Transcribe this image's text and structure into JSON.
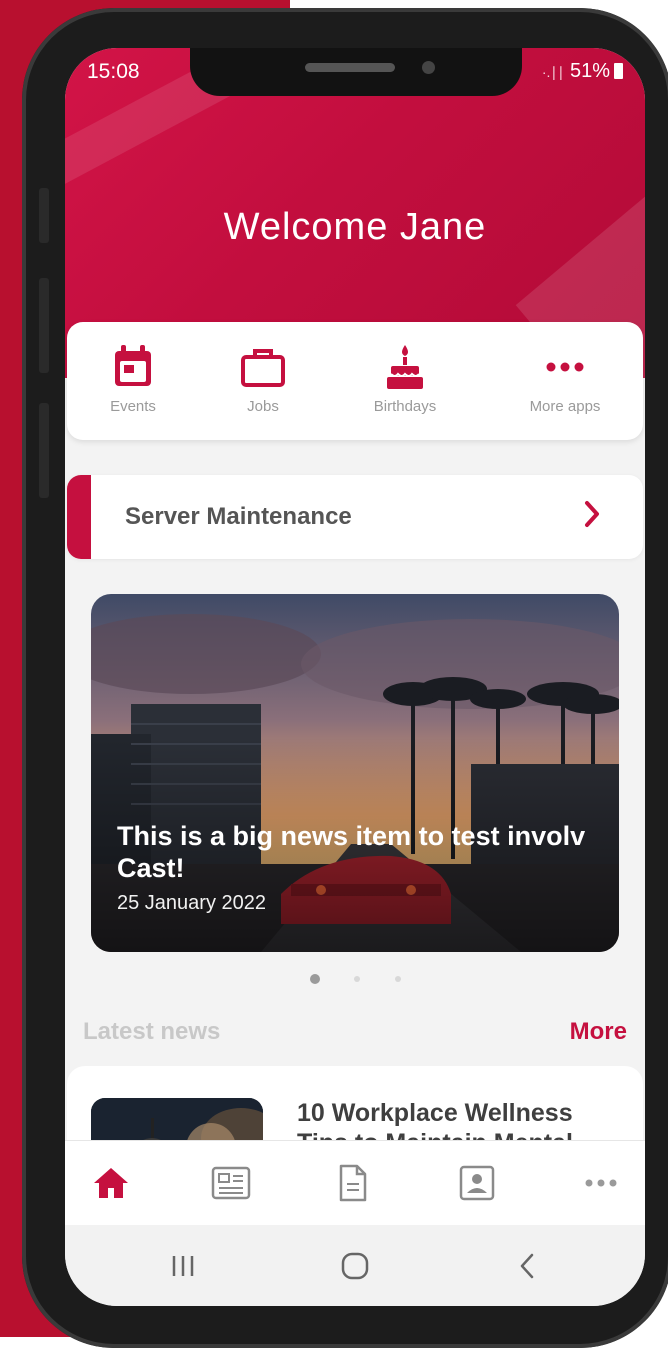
{
  "status_bar": {
    "time": "15:08",
    "signal": "·.∣∣",
    "battery": "51%"
  },
  "header": {
    "welcome": "Welcome Jane"
  },
  "apps": [
    {
      "label": "Events",
      "icon": "calendar-icon"
    },
    {
      "label": "Jobs",
      "icon": "briefcase-icon"
    },
    {
      "label": "Birthdays",
      "icon": "cake-icon"
    },
    {
      "label": "More apps",
      "icon": "more-dots-icon"
    }
  ],
  "maintenance": {
    "label": "Server Maintenance"
  },
  "featured": {
    "title": "This is a big news item to test involv Cast!",
    "date": "25 January 2022",
    "carousel_total": 3,
    "carousel_active": 1
  },
  "latest": {
    "label": "Latest news",
    "more": "More"
  },
  "news_list": [
    {
      "title": "10 Workplace Wellness Tips to Maintain Mental"
    }
  ],
  "tabbar": [
    "home-icon",
    "newspaper-icon",
    "document-icon",
    "contact-card-icon",
    "more-dots-icon"
  ],
  "colors": {
    "brand": "#c5103f",
    "accent_bg": "#b8102f",
    "muted_text": "#9a9a9a"
  }
}
